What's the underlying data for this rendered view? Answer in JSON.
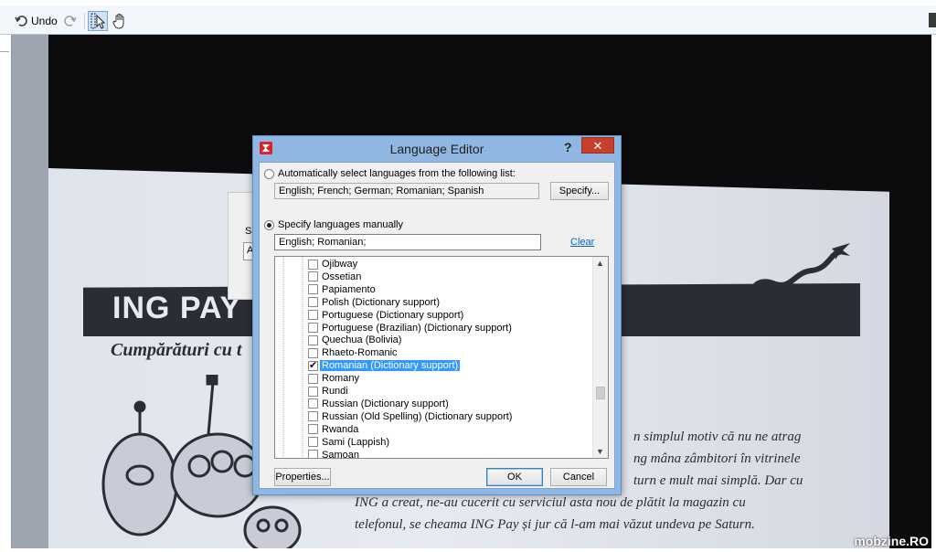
{
  "toolbar": {
    "undo_label": "Undo"
  },
  "background_document": {
    "brand_title": "ING PAY",
    "subtitle": "Cumpărături cu t",
    "body_lines": [
      "n simplul motiv că nu ne atrag",
      "ng mâna zâmbitori în vitrinele",
      "turn e mult mai simplă. Dar cu",
      "ING a creat, ne-au cucerit cu serviciul asta nou de plătit la magazin cu",
      "telefonul, se cheama ING Pay și jur că l-am mai văzut undeva pe Saturn."
    ],
    "back_dialog_label": "Selec",
    "back_dialog_field": "Auto"
  },
  "dialog": {
    "title": "Language Editor",
    "help_label": "?",
    "close_label": "✕",
    "auto_option_label": "Automatically select languages from the following list:",
    "auto_languages_value": "English; French; German; Romanian; Spanish",
    "specify_button": "Specify...",
    "manual_option_label": "Specify languages manually",
    "manual_languages_value": "English; Romanian;",
    "clear_link": "Clear",
    "languages": [
      {
        "label": "Ojibway",
        "checked": false,
        "selected": false
      },
      {
        "label": "Ossetian",
        "checked": false,
        "selected": false
      },
      {
        "label": "Papiamento",
        "checked": false,
        "selected": false
      },
      {
        "label": "Polish (Dictionary support)",
        "checked": false,
        "selected": false
      },
      {
        "label": "Portuguese (Dictionary support)",
        "checked": false,
        "selected": false
      },
      {
        "label": "Portuguese (Brazilian) (Dictionary support)",
        "checked": false,
        "selected": false
      },
      {
        "label": "Quechua (Bolivia)",
        "checked": false,
        "selected": false
      },
      {
        "label": "Rhaeto-Romanic",
        "checked": false,
        "selected": false
      },
      {
        "label": "Romanian (Dictionary support)",
        "checked": true,
        "selected": true
      },
      {
        "label": "Romany",
        "checked": false,
        "selected": false
      },
      {
        "label": "Rundi",
        "checked": false,
        "selected": false
      },
      {
        "label": "Russian (Dictionary support)",
        "checked": false,
        "selected": false
      },
      {
        "label": "Russian (Old Spelling) (Dictionary support)",
        "checked": false,
        "selected": false
      },
      {
        "label": "Rwanda",
        "checked": false,
        "selected": false
      },
      {
        "label": "Sami (Lappish)",
        "checked": false,
        "selected": false
      },
      {
        "label": "Samoan",
        "checked": false,
        "selected": false
      }
    ],
    "properties_button": "Properties...",
    "ok_button": "OK",
    "cancel_button": "Cancel"
  },
  "watermark": "mobzine.RO",
  "colors": {
    "selection": "#3399ff",
    "close_button": "#c7402e",
    "dialog_frame": "#8fb7e2",
    "link": "#0066cc"
  }
}
